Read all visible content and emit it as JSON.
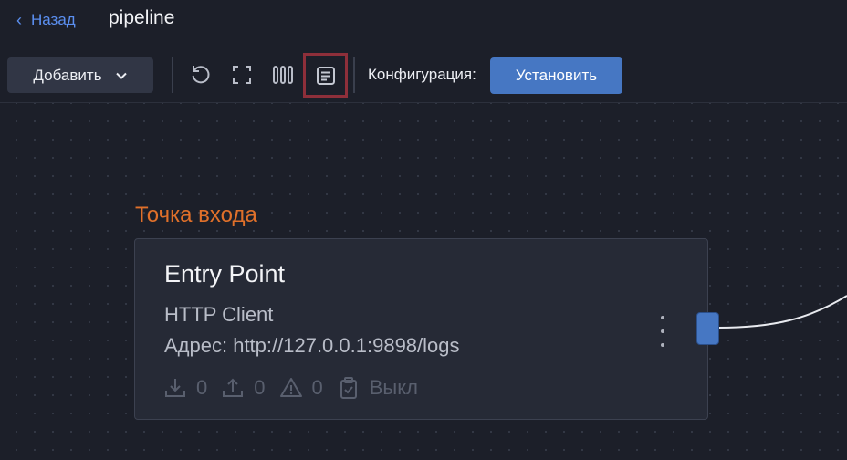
{
  "header": {
    "back_label": "Назад",
    "title": "pipeline"
  },
  "toolbar": {
    "add_label": "Добавить",
    "tools": [
      "undo-icon",
      "fit-screen-icon",
      "columns-icon",
      "logs-icon"
    ],
    "selected_tool": "logs-icon",
    "config_label": "Конфигурация:",
    "set_label": "Установить"
  },
  "node": {
    "label": "Точка входа",
    "title": "Entry Point",
    "type": "HTTP Client",
    "address": "Адрес: http://127.0.0.1:9898/logs",
    "stats": {
      "received": "0",
      "sent": "0",
      "errors": "0",
      "status": "Выкл"
    }
  },
  "colors": {
    "background": "#1c1f29",
    "accent": "#4677c3",
    "link": "#5b8ff0",
    "node_label": "#e0702a",
    "selection_outline": "#8e2f3a"
  }
}
